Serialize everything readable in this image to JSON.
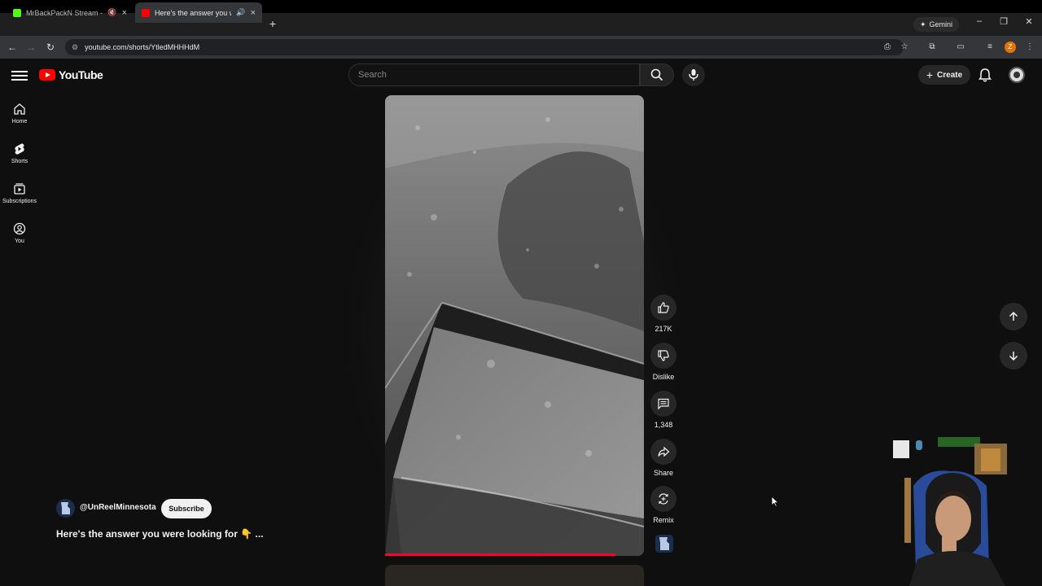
{
  "browser": {
    "tabs": [
      {
        "title": "MrBackPackN Stream - Wa",
        "favicon_color": "#53fc18",
        "active": false
      },
      {
        "title": "Here's the answer you were",
        "favicon_color": "#ff0000",
        "active": true
      }
    ],
    "gemini_label": "Gemini",
    "url": "youtube.com/shorts/YtledMHHHdM",
    "profile_initial": "Z"
  },
  "youtube": {
    "logo_text": "YouTube",
    "search_placeholder": "Search",
    "create_label": "Create",
    "sidebar": [
      {
        "label": "Home",
        "icon": "home-icon"
      },
      {
        "label": "Shorts",
        "icon": "shorts-icon"
      },
      {
        "label": "Subscriptions",
        "icon": "subscriptions-icon"
      },
      {
        "label": "You",
        "icon": "you-icon"
      }
    ],
    "short": {
      "channel": "@UnReelMinnesota",
      "subscribe_label": "Subscribe",
      "title": "Here's the answer you were looking for 👇 ...",
      "progress": 0.89,
      "actions": {
        "like_count": "217K",
        "dislike_label": "Dislike",
        "comment_count": "1,348",
        "share_label": "Share",
        "remix_label": "Remix"
      }
    }
  },
  "colors": {
    "background": "#0f0f0f",
    "accent_red": "#ff0033",
    "button_bg": "#272727"
  }
}
